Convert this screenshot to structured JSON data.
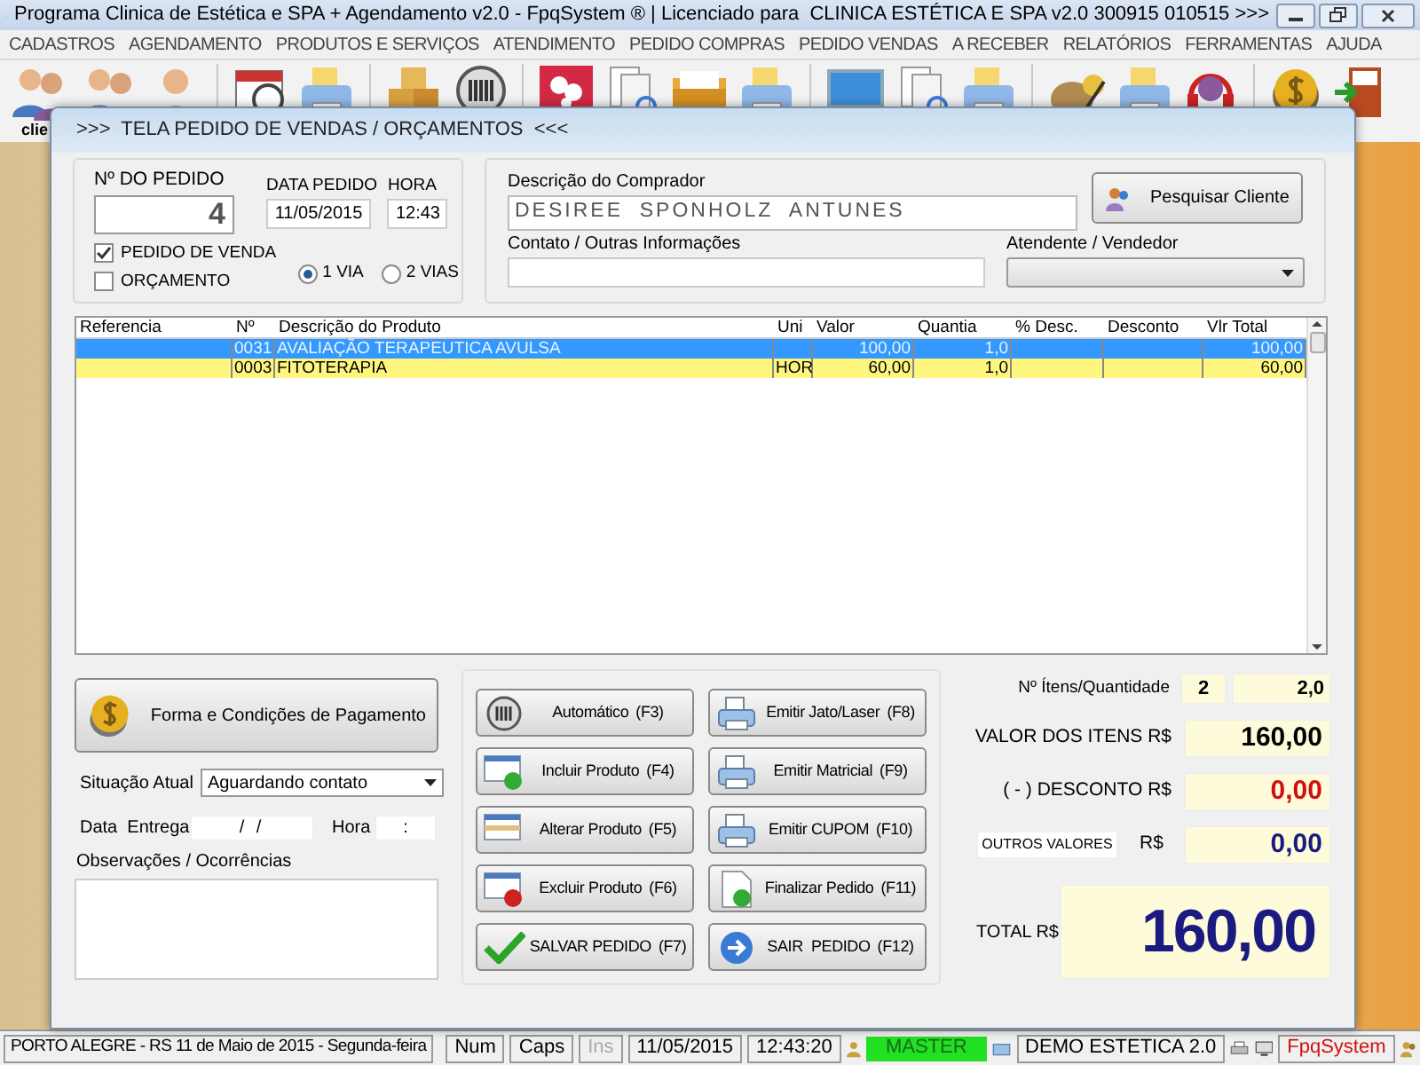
{
  "window": {
    "title": "Programa Clinica de Estética e SPA + Agendamento v2.0 - FpqSystem ® | Licenciado para  CLINICA ESTÉTICA E SPA v2.0 300915 010515 >>>"
  },
  "menu": [
    "CADASTROS",
    "AGENDAMENTO",
    "PRODUTOS E SERVIÇOS",
    "ATENDIMENTO",
    "PEDIDO COMPRAS",
    "PEDIDO VENDAS",
    "A RECEBER",
    "RELATÓRIOS",
    "FERRAMENTAS",
    "AJUDA"
  ],
  "toolbar": {
    "label": "clie",
    "items": [
      {
        "kind": "people"
      },
      {
        "kind": "people"
      },
      {
        "kind": "person"
      },
      {
        "kind": "separator"
      },
      {
        "kind": "calendar"
      },
      {
        "kind": "printer"
      },
      {
        "kind": "separator"
      },
      {
        "kind": "boxes"
      },
      {
        "kind": "barcode"
      },
      {
        "kind": "separator"
      },
      {
        "kind": "flower"
      },
      {
        "kind": "documents"
      },
      {
        "kind": "folder"
      },
      {
        "kind": "printer"
      },
      {
        "kind": "separator"
      },
      {
        "kind": "monitor"
      },
      {
        "kind": "documents"
      },
      {
        "kind": "printer"
      },
      {
        "kind": "separator"
      },
      {
        "kind": "moneybag"
      },
      {
        "kind": "printer"
      },
      {
        "kind": "headset"
      },
      {
        "kind": "separator"
      },
      {
        "kind": "coin"
      },
      {
        "kind": "exit"
      }
    ]
  },
  "dialog": {
    "title": ">>>  TELA PEDIDO DE VENDAS / ORÇAMENTOS  <<<",
    "order": {
      "number_label": "Nº DO PEDIDO",
      "number": "4",
      "date_label": "DATA PEDIDO",
      "date": "11/05/2015",
      "time_label": "HORA",
      "time": "12:43"
    },
    "order_types": [
      {
        "label": "PEDIDO DE VENDA",
        "checked": true
      },
      {
        "label": "ORÇAMENTO",
        "checked": false
      }
    ],
    "copies": [
      {
        "label": "1 VIA",
        "selected": true
      },
      {
        "label": "2 VIAS",
        "selected": false
      }
    ],
    "buyer": {
      "label": "Descrição do Comprador",
      "value": "DESIREE  SPONHOLZ  ANTUNES",
      "search_button": "Pesquisar Cliente",
      "contact_label": "Contato / Outras Informações",
      "seller_label": "Atendente / Vendedor"
    },
    "table": {
      "columns": [
        "Referencia",
        "Nº",
        "Descrição do Produto",
        "Uni",
        "Valor",
        "Quantia",
        "% Desc.",
        "Desconto",
        "Vlr Total"
      ],
      "rows": [
        {
          "selected": true,
          "cells": [
            "",
            "0031",
            "AVALIAÇÃO TERAPEUTICA AVULSA",
            "",
            "100,00",
            "1,0",
            "",
            "",
            "100,00"
          ]
        },
        {
          "selected": false,
          "cells": [
            "",
            "0003",
            "FITOTERAPIA",
            "HOR",
            "60,00",
            "1,0",
            "",
            "",
            "60,00"
          ]
        }
      ]
    },
    "payment_button": "Forma e Condições de Pagamento",
    "status_label": "Situação Atual",
    "status_value": "Aguardando contato",
    "delivery_label": "Data  Entrega",
    "delivery_date": "/ /",
    "time_label": "Hora",
    "delivery_time": ":",
    "notes_label": "Observações / Ocorrências",
    "buttons": [
      {
        "kind": "barcode",
        "label": "Automático",
        "key": "(F3)"
      },
      {
        "kind": "printer",
        "label": "Emitir Jato/Laser",
        "key": "(F8)"
      },
      {
        "kind": "add",
        "label": "Incluir Produto",
        "key": "(F4)"
      },
      {
        "kind": "printer",
        "label": "Emitir Matricial",
        "key": "(F9)"
      },
      {
        "kind": "edit",
        "label": "Alterar Produto",
        "key": "(F5)"
      },
      {
        "kind": "printer",
        "label": "Emitir CUPOM",
        "key": "(F10)"
      },
      {
        "kind": "remove",
        "label": "Excluir Produto",
        "key": "(F6)"
      },
      {
        "kind": "document",
        "label": "Finalizar Pedido",
        "key": "(F11)"
      },
      {
        "kind": "check",
        "label": "SALVAR PEDIDO",
        "key": "(F7)"
      },
      {
        "kind": "arrow",
        "label": "SAIR  PEDIDO",
        "key": "(F12)"
      }
    ],
    "totals": {
      "count_label": "Nº Ítens/Quantidade",
      "count": "2",
      "quantity": "2,0",
      "items_label": "VALOR DOS ITENS R$",
      "items_value": "160,00",
      "discount_label": "( - ) DESCONTO R$",
      "discount_value": "0,00",
      "other_label": "OUTROS VALORES",
      "other_currency": "R$",
      "other_value": "0,00",
      "total_label": "TOTAL R$",
      "total_value": "160,00"
    }
  },
  "status_bar": {
    "location": "PORTO ALEGRE - RS 11 de Maio de 2015 - Segunda-feira",
    "keys": [
      {
        "label": "Num",
        "disabled": false
      },
      {
        "label": "Caps",
        "disabled": false
      },
      {
        "label": "Ins",
        "disabled": true
      }
    ],
    "date": "11/05/2015",
    "time": "12:43:20",
    "user": "MASTER",
    "database": "DEMO ESTETICA 2.0",
    "brand": "FpqSystem"
  }
}
